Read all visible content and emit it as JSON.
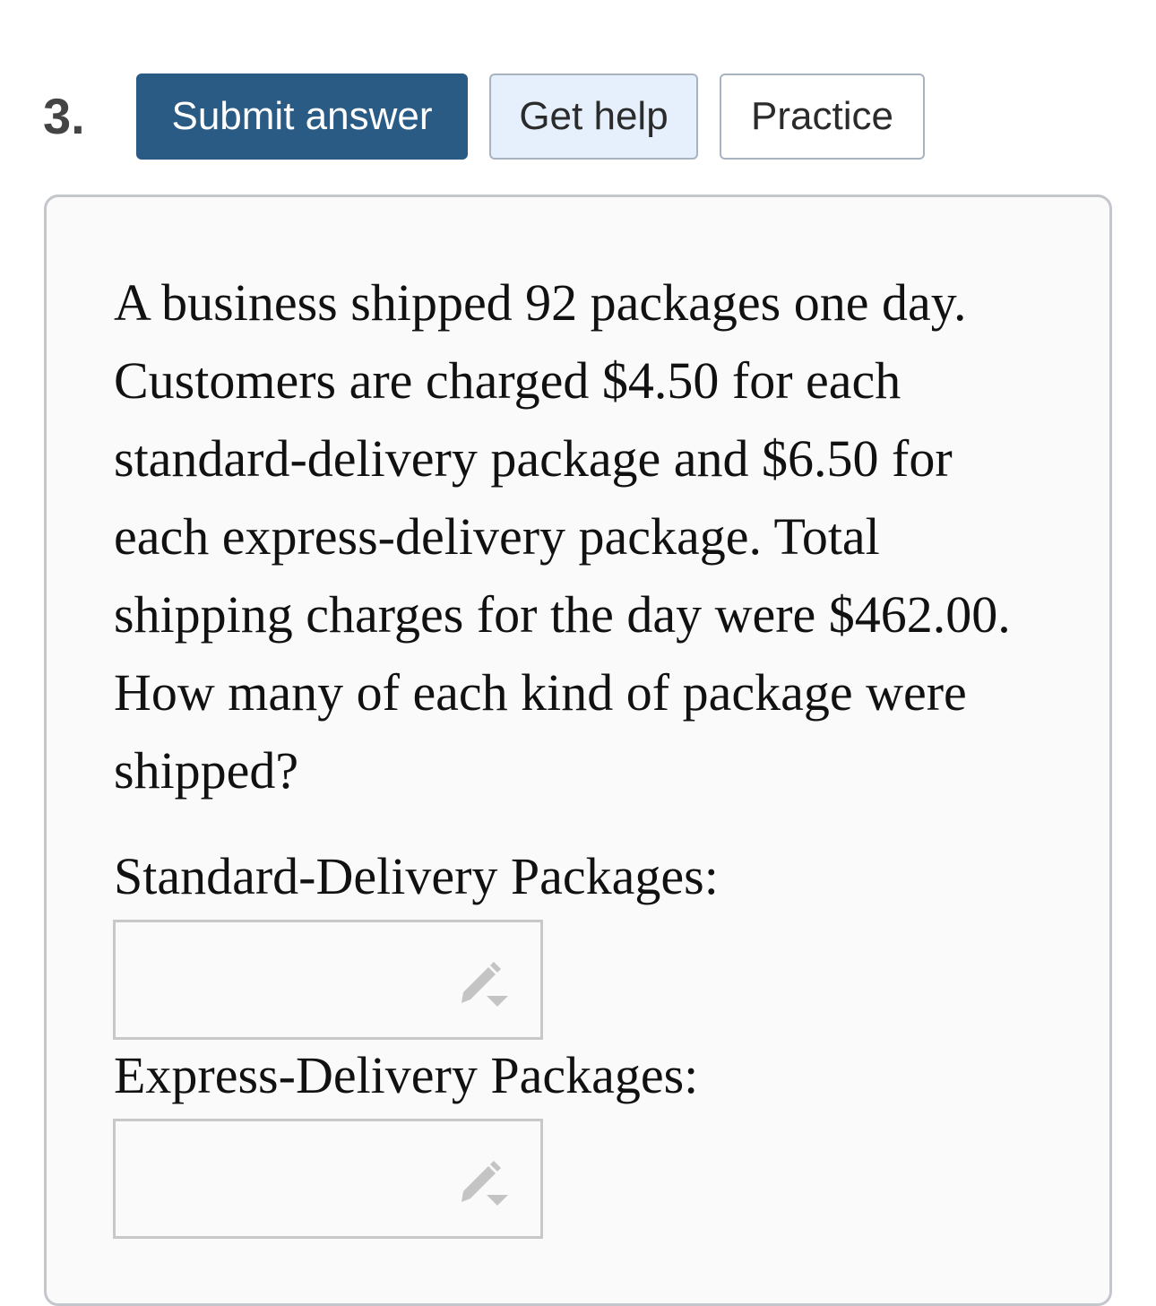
{
  "question": {
    "number": "3.",
    "text": "A business shipped 92 packages one day. Customers are charged $4.50 for each standard-delivery package and $6.50 for each express-delivery package. Total shipping charges for the day were $462.00. How many of each kind of package were shipped?"
  },
  "toolbar": {
    "submit_label": "Submit answer",
    "help_label": "Get help",
    "practice_label": "Practice"
  },
  "fields": {
    "standard": {
      "label": "Standard-Delivery Packages:",
      "value": "",
      "icon": "pencil-dropdown-icon"
    },
    "express": {
      "label": "Express-Delivery Packages:",
      "value": "",
      "icon": "pencil-dropdown-icon"
    }
  },
  "colors": {
    "submit_bg": "#2a5b84",
    "help_bg": "#e6f0fc",
    "panel_bg": "#fafafa",
    "border": "#c3c6cb"
  }
}
